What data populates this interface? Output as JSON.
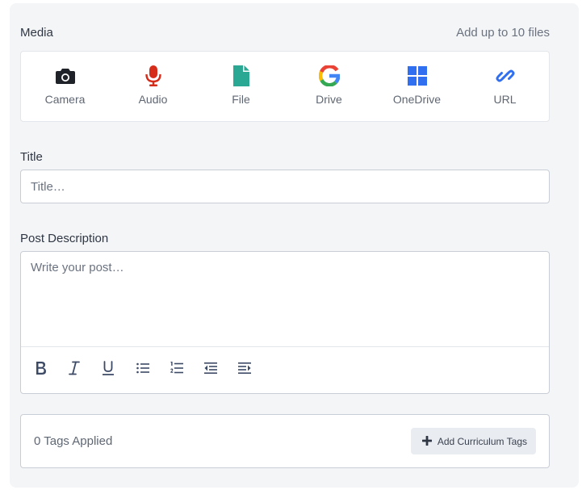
{
  "media": {
    "label": "Media",
    "limit_text": "Add up to 10 files",
    "sources": [
      {
        "label": "Camera",
        "icon": "camera-icon",
        "color": "#1f2329"
      },
      {
        "label": "Audio",
        "icon": "microphone-icon",
        "color": "#d62c1a"
      },
      {
        "label": "File",
        "icon": "file-icon",
        "color": "#2ba894"
      },
      {
        "label": "Drive",
        "icon": "google-drive-icon",
        "color": "#4285f4"
      },
      {
        "label": "OneDrive",
        "icon": "onedrive-icon",
        "color": "#2f6ff0"
      },
      {
        "label": "URL",
        "icon": "link-icon",
        "color": "#2f6ff0"
      }
    ]
  },
  "title_field": {
    "label": "Title",
    "placeholder": "Title…"
  },
  "description_field": {
    "label": "Post Description",
    "placeholder": "Write your post…",
    "toolbar": [
      "bold-icon",
      "italic-icon",
      "underline-icon",
      "bulleted-list-icon",
      "numbered-list-icon",
      "outdent-icon",
      "indent-icon"
    ]
  },
  "tags": {
    "count_text": "0 Tags Applied",
    "add_button_label": "Add Curriculum Tags"
  }
}
